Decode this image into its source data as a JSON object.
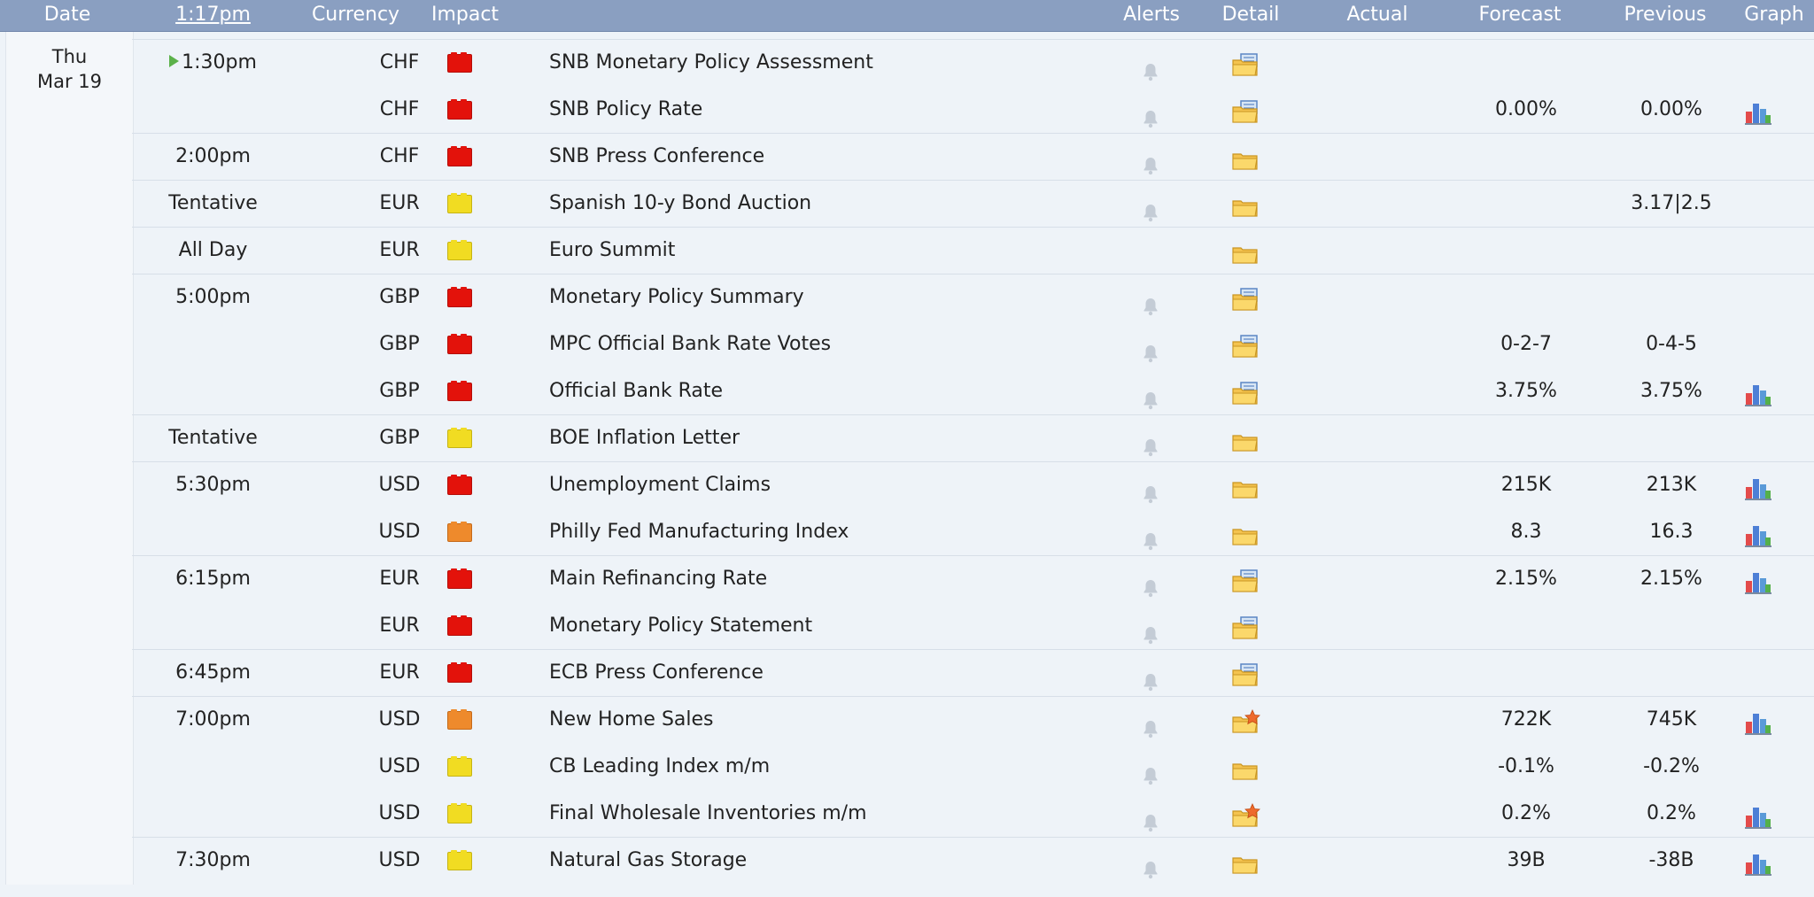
{
  "header": {
    "date": "Date",
    "time": "1:17pm",
    "currency": "Currency",
    "impact": "Impact",
    "alerts": "Alerts",
    "detail": "Detail",
    "actual": "Actual",
    "forecast": "Forecast",
    "previous": "Previous",
    "graph": "Graph"
  },
  "day": {
    "weekday": "Thu",
    "date": "Mar 19"
  },
  "impact_colors": {
    "high": "#e3120b",
    "medium": "#ee8a2c",
    "low": "#f1dc22"
  },
  "rows": [
    {
      "time": "1:30pm",
      "current": true,
      "currency": "CHF",
      "impact": "high",
      "event": "SNB Monetary Policy Assessment",
      "alert": true,
      "detail": "folder-updated-icon",
      "forecast": "",
      "previous": "",
      "graph": false
    },
    {
      "time": "",
      "currency": "CHF",
      "impact": "high",
      "event": "SNB Policy Rate",
      "alert": true,
      "detail": "folder-updated-icon",
      "forecast": "0.00%",
      "previous": "0.00%",
      "graph": true
    },
    {
      "time": "2:00pm",
      "currency": "CHF",
      "impact": "high",
      "event": "SNB Press Conference",
      "alert": true,
      "detail": "folder-icon",
      "forecast": "",
      "previous": "",
      "graph": false
    },
    {
      "time": "Tentative",
      "currency": "EUR",
      "impact": "low",
      "event": "Spanish 10-y Bond Auction",
      "alert": true,
      "detail": "folder-icon",
      "forecast": "",
      "previous": "3.17|2.5",
      "graph": false
    },
    {
      "time": "All Day",
      "currency": "EUR",
      "impact": "low",
      "event": "Euro Summit",
      "alert": false,
      "detail": "folder-icon",
      "forecast": "",
      "previous": "",
      "graph": false
    },
    {
      "time": "5:00pm",
      "currency": "GBP",
      "impact": "high",
      "event": "Monetary Policy Summary",
      "alert": true,
      "detail": "folder-updated-icon",
      "forecast": "",
      "previous": "",
      "graph": false
    },
    {
      "time": "",
      "currency": "GBP",
      "impact": "high",
      "event": "MPC Official Bank Rate Votes",
      "alert": true,
      "detail": "folder-updated-icon",
      "forecast": "0-2-7",
      "previous": "0-4-5",
      "graph": false
    },
    {
      "time": "",
      "currency": "GBP",
      "impact": "high",
      "event": "Official Bank Rate",
      "alert": true,
      "detail": "folder-updated-icon",
      "forecast": "3.75%",
      "previous": "3.75%",
      "graph": true
    },
    {
      "time": "Tentative",
      "currency": "GBP",
      "impact": "low",
      "event": "BOE Inflation Letter",
      "alert": true,
      "detail": "folder-icon",
      "forecast": "",
      "previous": "",
      "graph": false
    },
    {
      "time": "5:30pm",
      "currency": "USD",
      "impact": "high",
      "event": "Unemployment Claims",
      "alert": true,
      "detail": "folder-icon",
      "forecast": "215K",
      "previous": "213K",
      "graph": true
    },
    {
      "time": "",
      "currency": "USD",
      "impact": "medium",
      "event": "Philly Fed Manufacturing Index",
      "alert": true,
      "detail": "folder-icon",
      "forecast": "8.3",
      "previous": "16.3",
      "graph": true
    },
    {
      "time": "6:15pm",
      "currency": "EUR",
      "impact": "high",
      "event": "Main Refinancing Rate",
      "alert": true,
      "detail": "folder-updated-icon",
      "forecast": "2.15%",
      "previous": "2.15%",
      "graph": true
    },
    {
      "time": "",
      "currency": "EUR",
      "impact": "high",
      "event": "Monetary Policy Statement",
      "alert": true,
      "detail": "folder-updated-icon",
      "forecast": "",
      "previous": "",
      "graph": false
    },
    {
      "time": "6:45pm",
      "currency": "EUR",
      "impact": "high",
      "event": "ECB Press Conference",
      "alert": true,
      "detail": "folder-updated-icon",
      "forecast": "",
      "previous": "",
      "graph": false
    },
    {
      "time": "7:00pm",
      "currency": "USD",
      "impact": "medium",
      "event": "New Home Sales",
      "alert": true,
      "detail": "folder-star-icon",
      "forecast": "722K",
      "previous": "745K",
      "graph": true
    },
    {
      "time": "",
      "currency": "USD",
      "impact": "low",
      "event": "CB Leading Index m/m",
      "alert": true,
      "detail": "folder-icon",
      "forecast": "-0.1%",
      "previous": "-0.2%",
      "graph": false
    },
    {
      "time": "",
      "currency": "USD",
      "impact": "low",
      "event": "Final Wholesale Inventories m/m",
      "alert": true,
      "detail": "folder-star-icon",
      "forecast": "0.2%",
      "previous": "0.2%",
      "graph": true
    },
    {
      "time": "7:30pm",
      "currency": "USD",
      "impact": "low",
      "event": "Natural Gas Storage",
      "alert": true,
      "detail": "folder-icon",
      "forecast": "39B",
      "previous": "-38B",
      "graph": true
    }
  ]
}
